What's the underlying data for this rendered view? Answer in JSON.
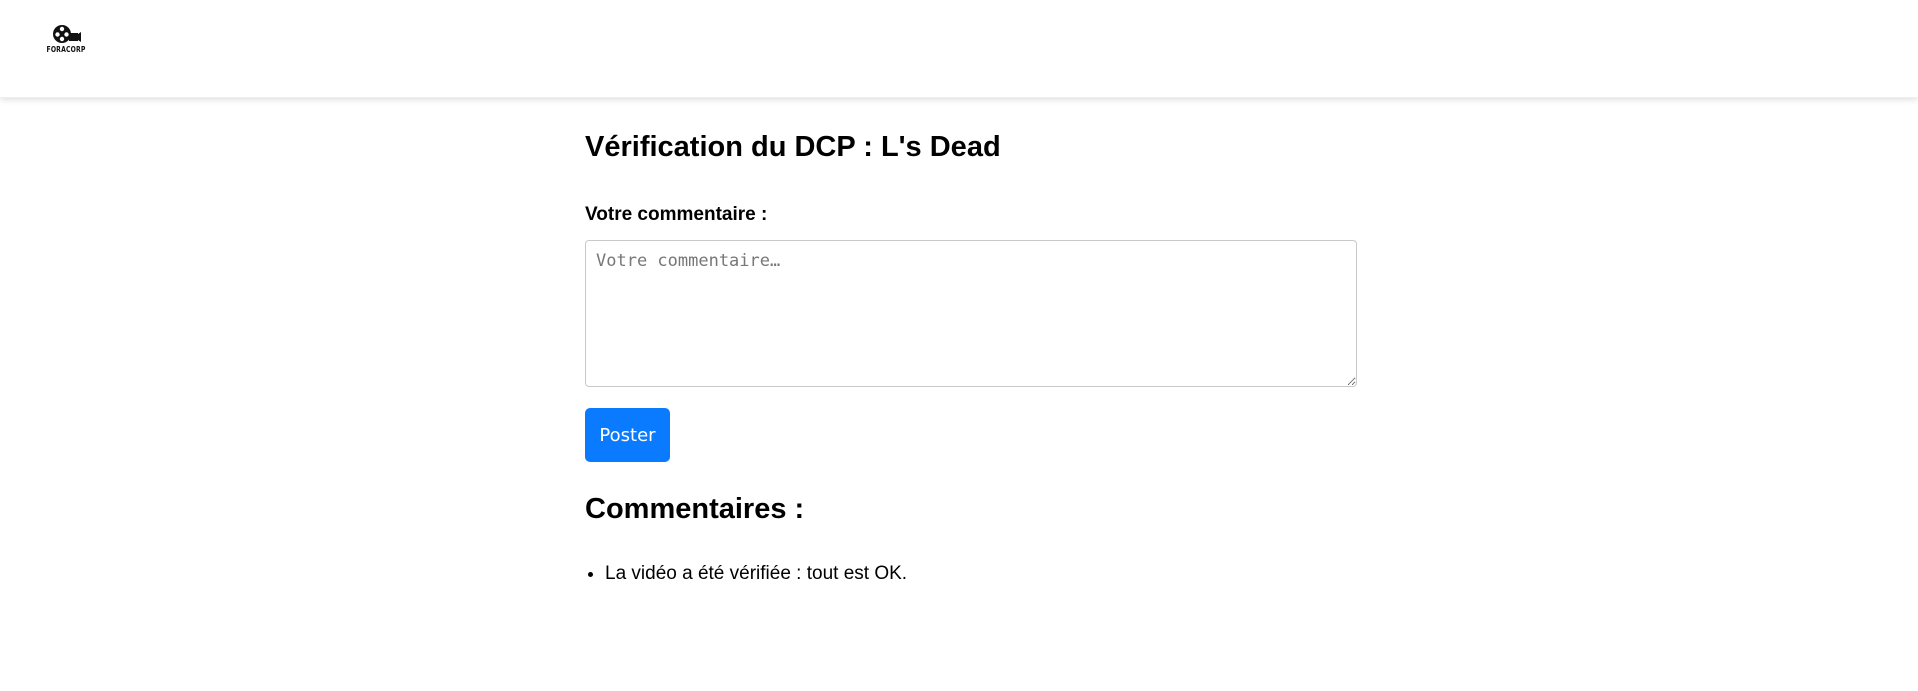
{
  "header": {
    "logo_text": "FORACORP",
    "logo_icon": "film-reel-camera-icon"
  },
  "main": {
    "title": "Vérification du DCP : L's Dead",
    "form": {
      "label": "Votre commentaire :",
      "textarea_value": "",
      "textarea_placeholder": "Votre commentaire…",
      "submit_label": "Poster"
    },
    "comments": {
      "heading": "Commentaires :",
      "items": [
        "La vidéo a été vérifiée : tout est OK."
      ]
    }
  },
  "colors": {
    "primary_button": "#0a7bff",
    "header_background": "#ffffff"
  }
}
